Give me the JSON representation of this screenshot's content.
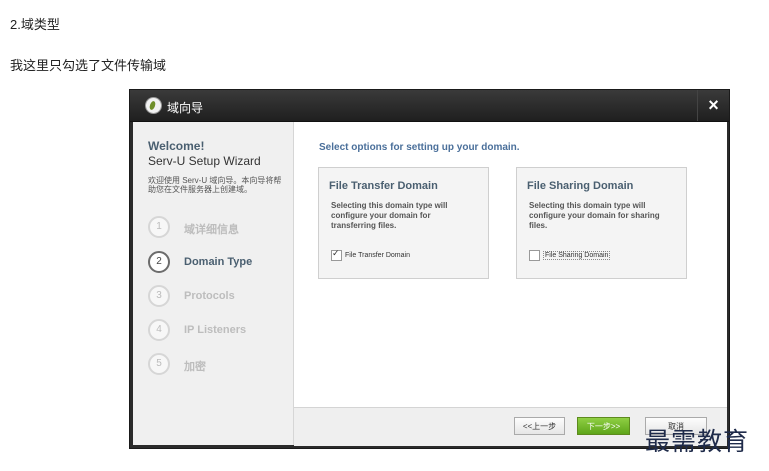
{
  "page": {
    "heading": "2.域类型",
    "note": "我这里只勾选了文件传输域"
  },
  "dialog": {
    "title": "域向导",
    "close": "×",
    "sidebar": {
      "welcome": "Welcome!",
      "wizard_name": "Serv-U Setup Wizard",
      "description": "欢迎使用 Serv-U 域向导。本向导将帮助您在文件服务器上创建域。",
      "steps": [
        {
          "num": "1",
          "label": "域详细信息"
        },
        {
          "num": "2",
          "label": "Domain Type"
        },
        {
          "num": "3",
          "label": "Protocols"
        },
        {
          "num": "4",
          "label": "IP Listeners"
        },
        {
          "num": "5",
          "label": "加密"
        }
      ]
    },
    "main": {
      "title": "Select options for setting up your domain.",
      "options": [
        {
          "title": "File Transfer Domain",
          "description": "Selecting this domain type will configure your domain for transferring files.",
          "checkbox_label": "File Transfer Domain",
          "checked": true
        },
        {
          "title": "File Sharing Domain",
          "description": "Selecting this domain type will configure your domain for sharing files.",
          "checkbox_label": "File Sharing Domain",
          "checked": false
        }
      ]
    },
    "footer": {
      "prev": "<<上一步",
      "next": "下一步>>",
      "cancel": "取消"
    }
  },
  "watermark": "最需教育",
  "colors": {
    "accent": "#4a5f70",
    "link_blue": "#4a6f9a",
    "next_green": "#6fb526",
    "titlebar": "#2b2b2b"
  }
}
